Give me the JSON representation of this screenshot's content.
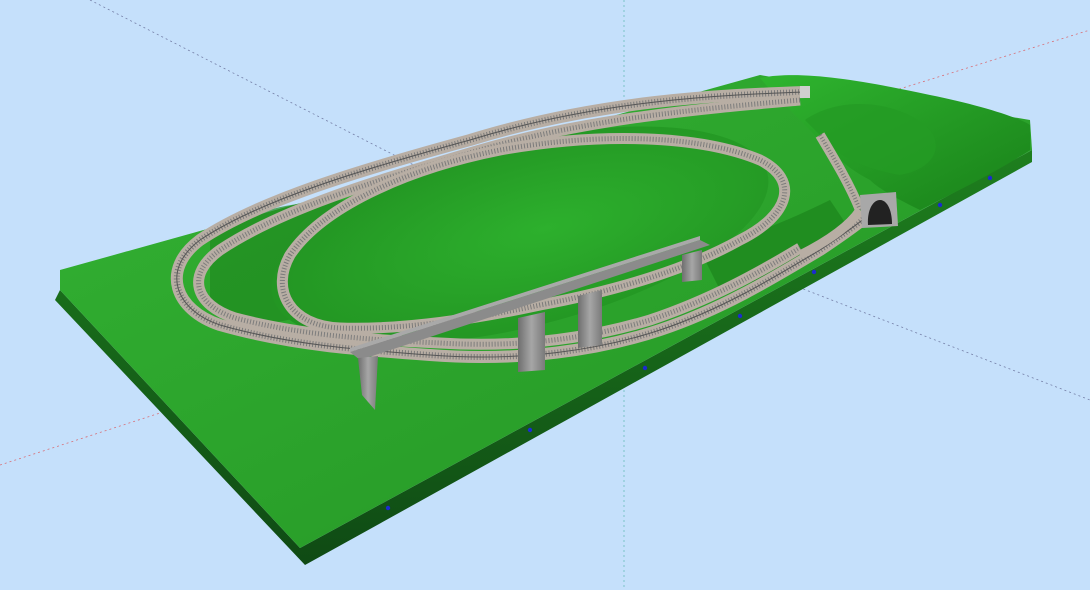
{
  "scene": {
    "kind": "3d-track-layout-preview",
    "background_color": "#c5e0fb",
    "terrain_color": "#2ba22b",
    "terrain_dark_color": "#1b6e1b",
    "base_edge_color": "#14521a",
    "rail_color": "#8a8a8a",
    "ballast_color": "#b7aea4",
    "pier_color": "#8f8f8f",
    "tunnel_color": "#a8a8a8",
    "axis_colors": {
      "x": "#e04040",
      "y": "#40c0a0",
      "z": "#303050"
    },
    "objects": {
      "baseboard": "baseboard",
      "outer_loop": "outer-track-loop",
      "inner_loop": "inner-track-loop",
      "viaduct": "viaduct",
      "tunnel": "tunnel-portal",
      "branch_track": "branch-track",
      "hill": "hill"
    }
  }
}
